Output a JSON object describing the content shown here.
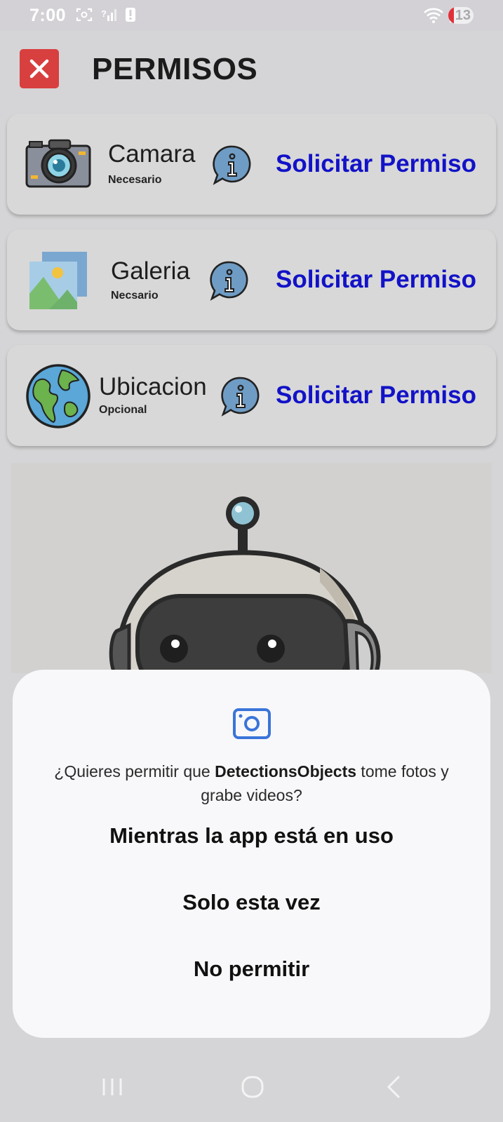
{
  "status_bar": {
    "time": "7:00",
    "battery_level": "13",
    "icons_left": [
      "screenshot-icon",
      "no-signal-icon",
      "alert-icon"
    ],
    "icons_right": [
      "wifi-icon",
      "signal-icon"
    ]
  },
  "header": {
    "title": "PERMISOS",
    "close_icon": "close-icon",
    "close_color": "#d83f3f"
  },
  "permissions": [
    {
      "title": "Camara",
      "subtitle": "Necesario",
      "action": "Solicitar Permiso",
      "icon": "camera-icon"
    },
    {
      "title": "Galeria",
      "subtitle": "Necsario",
      "action": "Solicitar Permiso",
      "icon": "gallery-icon"
    },
    {
      "title": "Ubicacion",
      "subtitle": "Opcional",
      "action": "Solicitar Permiso",
      "icon": "globe-icon"
    }
  ],
  "colors": {
    "action": "#1212c8",
    "dialog_accent": "#3b74d9"
  },
  "dialog": {
    "icon": "camera-icon",
    "message_prefix": "¿Quieres permitir que ",
    "app_name": "DetectionsObjects",
    "message_suffix": " tome fotos y grabe videos?",
    "buttons": [
      "Mientras la app está en uso",
      "Solo esta vez",
      "No permitir"
    ]
  },
  "nav_bar": {
    "items": [
      "recent-apps-icon",
      "home-icon",
      "back-icon"
    ]
  }
}
